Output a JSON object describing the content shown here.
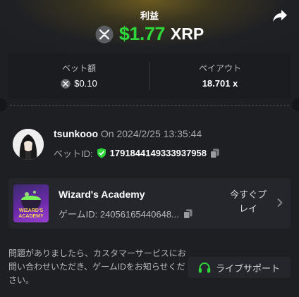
{
  "header": {
    "profit_label": "利益",
    "amount": "$1.77",
    "currency": "XRP"
  },
  "stats": {
    "bet_label": "ベット額",
    "bet_value": "$0.10",
    "payout_label": "ペイアウト",
    "payout_value": "18.701 x"
  },
  "bet": {
    "username": "tsunkooo",
    "date_text": "On 2024/2/25 13:35:44",
    "bet_id_label": "ベットID:",
    "bet_id": "1791844149333937958"
  },
  "game": {
    "title": "Wizard's Academy",
    "thumb_text_1": "WIZARD'S",
    "thumb_text_2": "ACADEMY",
    "game_id_text": "ゲームID: 24056165440648...",
    "play_label_1": "今すぐプ",
    "play_label_2": "レイ"
  },
  "support": {
    "help_text": "問題がありましたら、カスタマーサービスにお問い合わせいただき、ゲームIDをお知らせください。",
    "button_label": "ライブサポート"
  },
  "colors": {
    "profit_green": "#2fd63a",
    "background": "#1d1f23",
    "verified_green": "#2fd63a",
    "support_green": "#2fd63a"
  },
  "icons": [
    "share-icon",
    "xrp-coin-icon",
    "shield-check-icon",
    "copy-icon",
    "chevron-right-icon",
    "headset-icon"
  ]
}
